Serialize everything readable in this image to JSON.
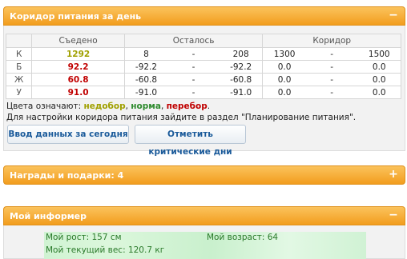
{
  "colors": {
    "header_orange": "#f29d1e",
    "under": "#a0a000",
    "norm": "#2e8b2e",
    "over": "#c00000",
    "link_blue": "#1a5a9a"
  },
  "corridor_panel": {
    "title": "Коридор питания за день",
    "toggle": "−",
    "headers": {
      "eaten": "Съедено",
      "remaining": "Осталось",
      "corridor": "Коридор"
    },
    "rows": [
      {
        "label": "К",
        "eaten": "1292",
        "eaten_status": "under",
        "rem_from": "8",
        "rem_dash": "-",
        "rem_to": "208",
        "cor_from": "1300",
        "cor_dash": "-",
        "cor_to": "1500"
      },
      {
        "label": "Б",
        "eaten": "92.2",
        "eaten_status": "over",
        "rem_from": "-92.2",
        "rem_dash": "-",
        "rem_to": "-92.2",
        "cor_from": "0.0",
        "cor_dash": "-",
        "cor_to": "0.0"
      },
      {
        "label": "Ж",
        "eaten": "60.8",
        "eaten_status": "over",
        "rem_from": "-60.8",
        "rem_dash": "-",
        "rem_to": "-60.8",
        "cor_from": "0.0",
        "cor_dash": "-",
        "cor_to": "0.0"
      },
      {
        "label": "У",
        "eaten": "91.0",
        "eaten_status": "over",
        "rem_from": "-91.0",
        "rem_dash": "-",
        "rem_to": "-91.0",
        "cor_from": "0.0",
        "cor_dash": "-",
        "cor_to": "0.0"
      }
    ],
    "legend_prefix": "Цвета означают: ",
    "legend_under": "недобор",
    "legend_sep1": ", ",
    "legend_norm": "норма",
    "legend_sep2": ", ",
    "legend_over": "перебор",
    "legend_end": ".",
    "settings_hint": "Для настройки коридора питания зайдите в раздел \"Планирование питания\".",
    "button_today": "Ввод данных за сегодня",
    "button_critical": "Отметить критические дни"
  },
  "rewards_panel": {
    "title": "Награды и подарки: 4",
    "toggle": "+"
  },
  "informer_panel": {
    "title": "Мой информер",
    "toggle": "−",
    "height_text": "Мой рост: 157 см",
    "age_text": "Мой возраст: 64",
    "weight_text": "Мой текущий вес: 120.7 кг"
  }
}
